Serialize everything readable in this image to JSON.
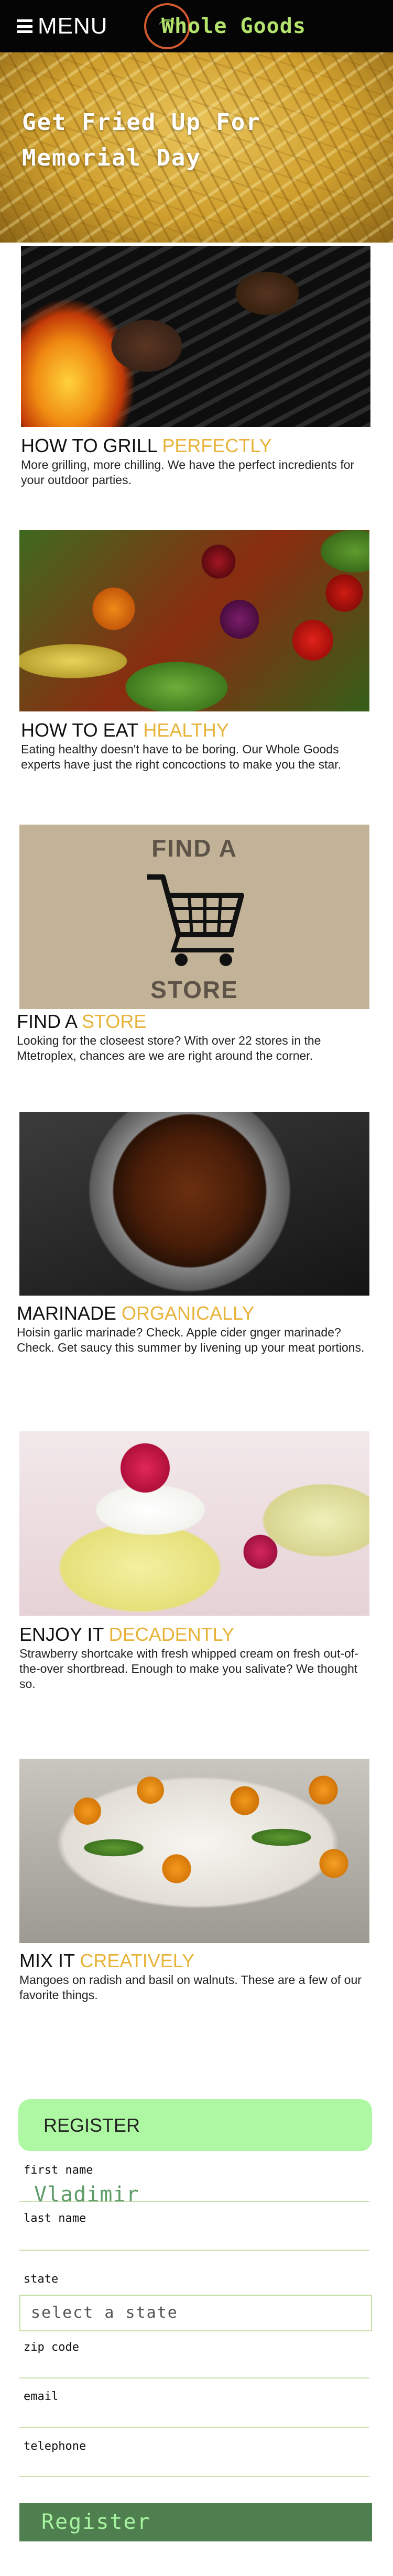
{
  "header": {
    "menu_label": "MENU",
    "brand": "Whole Goods"
  },
  "hero": {
    "title": "Get Fried Up For Memorial Day"
  },
  "features": [
    {
      "title_main": "HOW TO GRILL ",
      "title_accent": "PERFECTLY",
      "description": "More grilling, more chilling. We have the perfect incredients for your outdoor parties."
    },
    {
      "title_main": "HOW TO EAT ",
      "title_accent": "HEALTHY",
      "description": "Eating healthy doesn't have to be boring. Our Whole Goods experts have just the right concoctions to make you the star."
    },
    {
      "title_main": "FIND A ",
      "title_accent": "STORE",
      "description": "Looking for the closeest store? With over 22 stores in the Mtetroplex, chances are we are right around the corner.",
      "image_text_top": "FIND A",
      "image_text_bottom": "STORE"
    },
    {
      "title_main": "MARINADE ",
      "title_accent": "ORGANICALLY",
      "description": "Hoisin garlic marinade? Check. Apple cider gnger marinade? Check. Get saucy this summer by livening up your meat portions."
    },
    {
      "title_main": "ENJOY IT ",
      "title_accent": "DECADENTLY",
      "description": "Strawberry shortcake with fresh whipped cream on fresh out-of-the-over shortbread. Enough to make you salivate? We thought so."
    },
    {
      "title_main": "MIX IT ",
      "title_accent": "CREATIVELY",
      "description": "Mangoes on radish and basil on walnuts. These are a few of our favorite things."
    }
  ],
  "register": {
    "heading": "REGISTER",
    "first_name_label": "first name",
    "first_name_value": "Vladimir",
    "last_name_label": "last name",
    "state_label": "state",
    "state_placeholder": "select a state",
    "zip_label": "zip code",
    "email_label": "email",
    "telephone_label": "telephone",
    "submit_label": "Register"
  },
  "colors": {
    "accent": "#e7b339",
    "brand_green": "#b3e36c",
    "register_banner": "#aef7a3",
    "submit_bg": "#4f7f4f",
    "submit_text": "#a6f2a0"
  }
}
